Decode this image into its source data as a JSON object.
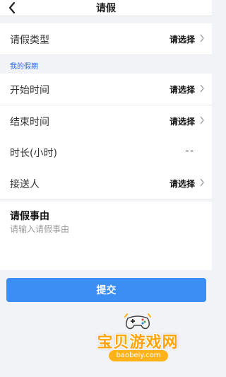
{
  "header": {
    "title": "请假",
    "back_icon": "back-chevron-icon"
  },
  "leave_type": {
    "label": "请假类型",
    "value": "请选择"
  },
  "section": {
    "label": "我的假期"
  },
  "start_time": {
    "label": "开始时间",
    "value": "请选择"
  },
  "end_time": {
    "label": "结束时间",
    "value": "请选择"
  },
  "duration": {
    "label": "时长(小时)",
    "value": "--"
  },
  "escort": {
    "label": "接送人",
    "value": "请选择"
  },
  "reason": {
    "title": "请假事由",
    "placeholder": "请输入请假事由"
  },
  "submit": {
    "label": "提交"
  },
  "watermark": {
    "text": "宝贝游戏网",
    "url": "baobeiy.com"
  },
  "colors": {
    "accent": "#3a8ef4",
    "section_text": "#2b66f6",
    "background": "#f2f3f6",
    "watermark": "#ffa40a"
  }
}
